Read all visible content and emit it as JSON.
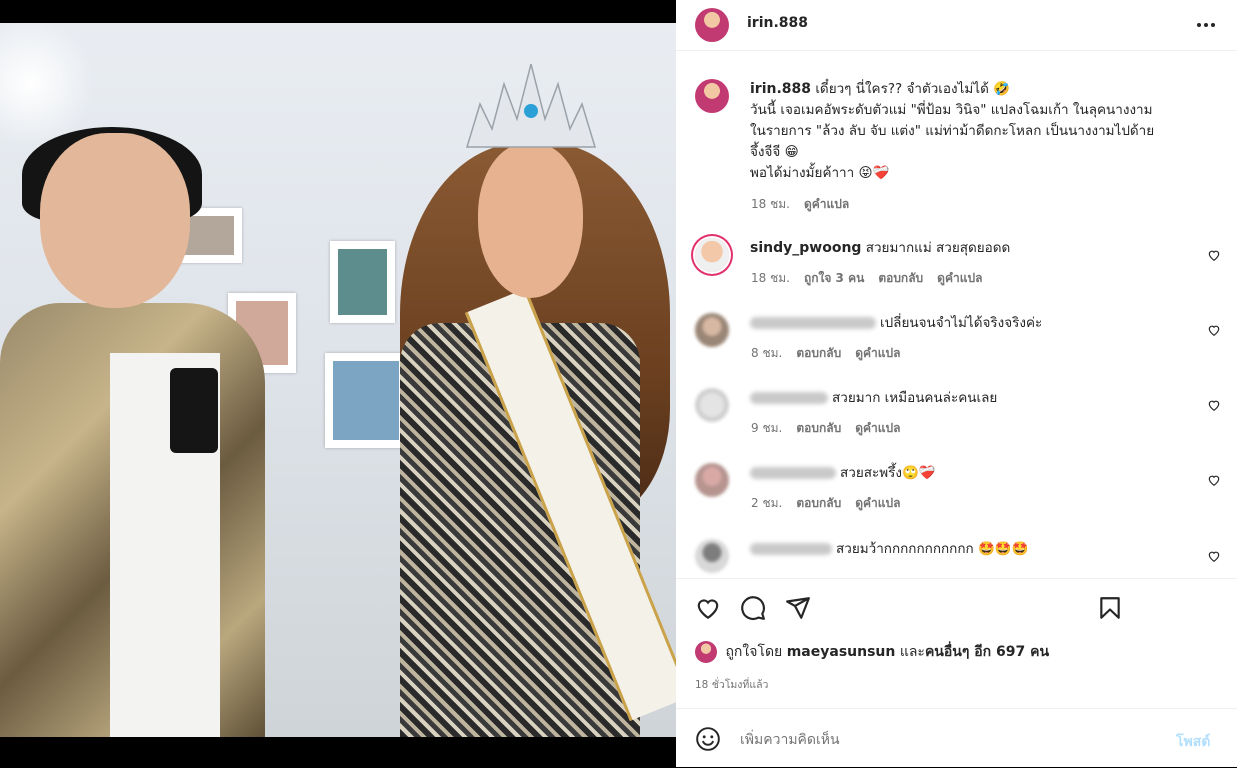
{
  "post": {
    "username": "irin.888",
    "caption_user": "irin.888",
    "caption_lines": [
      "เดี๋ยวๆ นี่ใคร?? จำตัวเองไม่ได้ 🤣",
      "วันนี้ เจอเมคอัพระดับตัวแม่ \"พี่ป้อม วินิจ\" แปลงโฉมเก้า ในลุคนางงาม",
      "ในรายการ \"ล้วง ลับ จับ แต่ง\" แม่ท่าม้าดีดกะโหลก เป็นนางงามไปด้าย",
      "จึ้งจีจี 😁",
      "พอได้ม่างมั้ยค้าาา 😝❤️‍🩹"
    ],
    "caption_time": "18 ชม.",
    "caption_translate": "ดูคำแปล",
    "likes_prefix": "ถูกใจโดย",
    "likes_user": "maeyasunsun",
    "likes_and": "และ",
    "likes_others": "คนอื่นๆ อีก 697 คน",
    "post_time": "18 ชั่วโมงที่แล้ว",
    "add_comment_placeholder": "เพิ่มความคิดเห็น",
    "post_button": "โพสต์"
  },
  "comments": [
    {
      "user": "sindy_pwoong",
      "user_visible": true,
      "text": "สวยมากแม่ สวยสุดยอดด",
      "time": "18 ชม.",
      "likes": "ถูกใจ 3 คน",
      "reply": "ตอบกลับ",
      "translate": "ดูคำแปล"
    },
    {
      "user": "",
      "user_visible": false,
      "text": "เปลี่ยนจนจำไม่ได้จริงจริงค่ะ",
      "time": "8 ชม.",
      "likes": "",
      "reply": "ตอบกลับ",
      "translate": "ดูคำแปล"
    },
    {
      "user": "",
      "user_visible": false,
      "text": "สวยมาก เหมือนคนล่ะคนเลย",
      "time": "9 ชม.",
      "likes": "",
      "reply": "ตอบกลับ",
      "translate": "ดูคำแปล"
    },
    {
      "user": "",
      "user_visible": false,
      "text": "สวยสะพรึ้ง🙄❤️‍🩹",
      "time": "2 ชม.",
      "likes": "",
      "reply": "ตอบกลับ",
      "translate": "ดูคำแปล"
    },
    {
      "user": "",
      "user_visible": false,
      "text": "สวยมว้ากกกกกกกกกกก 🤩🤩🤩",
      "time": "",
      "likes": "",
      "reply": "",
      "translate": ""
    }
  ],
  "icons": {
    "more": "more-options-icon",
    "like": "heart-icon",
    "comment": "comment-icon",
    "share": "share-icon",
    "save": "bookmark-icon",
    "emoji": "emoji-icon"
  },
  "colors": {
    "accent_link": "#b2dffc",
    "muted": "#737373",
    "border": "#efefef",
    "story_ring": "#e1306c"
  }
}
